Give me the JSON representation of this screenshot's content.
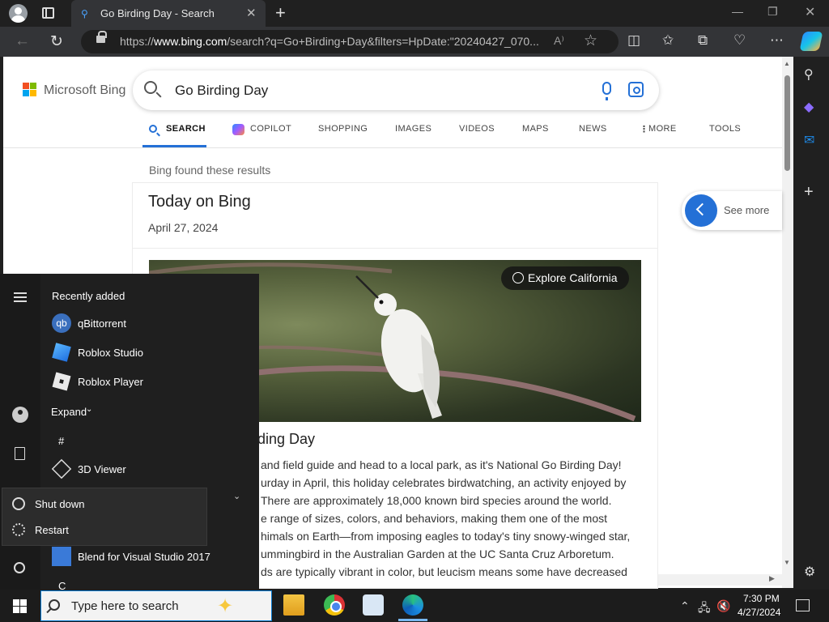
{
  "browser": {
    "tab_title": "Go Birding Day - Search",
    "new_tab_symbol": "+",
    "url_prefix": "https://",
    "url_domain": "www.bing.com",
    "url_rest": "/search?q=Go+Birding+Day&filters=HpDate:\"20240427_070..."
  },
  "bing": {
    "logo_text": "Microsoft Bing",
    "search_value": "Go Birding Day",
    "scopes": [
      "SEARCH",
      "COPILOT",
      "SHOPPING",
      "IMAGES",
      "VIDEOS",
      "MAPS",
      "NEWS",
      "MORE",
      "TOOLS"
    ],
    "found_text": "Bing found these results",
    "card_title": "Today on Bing",
    "card_date": "April 27, 2024",
    "explore_label": "Explore California",
    "see_more_label": "See more",
    "article_title_partial": "ding Day",
    "article_lines": [
      "and field guide and head to a local park, as it's National Go Birding Day!",
      "urday in April, this holiday celebrates birdwatching, an activity enjoyed by",
      "There are approximately 18,000 known bird species around the world.",
      "e range of sizes, colors, and behaviors, making them one of the most",
      "himals on Earth—from imposing eagles to today's tiny snowy-winged star,",
      "ummingbird in the Australian Garden at the UC Santa Cruz Arboretum.",
      "ds are typically vibrant in color, but leucism means some have decreased"
    ]
  },
  "start_menu": {
    "recently_added": "Recently added",
    "apps": [
      "qBittorrent",
      "Roblox Studio",
      "Roblox Player"
    ],
    "qb_glyph": "qb",
    "expand_label": "Expand",
    "expand_chevron": "⌄",
    "section_hash": "#",
    "viewer_app": "3D Viewer",
    "section_chevron": "⌄",
    "power_options": [
      "Shut down",
      "Restart"
    ],
    "blend_app": "Blend for Visual Studio 2017",
    "section_c": "C"
  },
  "taskbar": {
    "search_placeholder": "Type here to search",
    "time": "7:30 PM",
    "date": "4/27/2024"
  },
  "colors": {
    "accent": "#2470d6",
    "ms_red": "#f25022",
    "ms_green": "#7fba00",
    "ms_blue": "#00a4ef",
    "ms_yellow": "#ffb900"
  }
}
